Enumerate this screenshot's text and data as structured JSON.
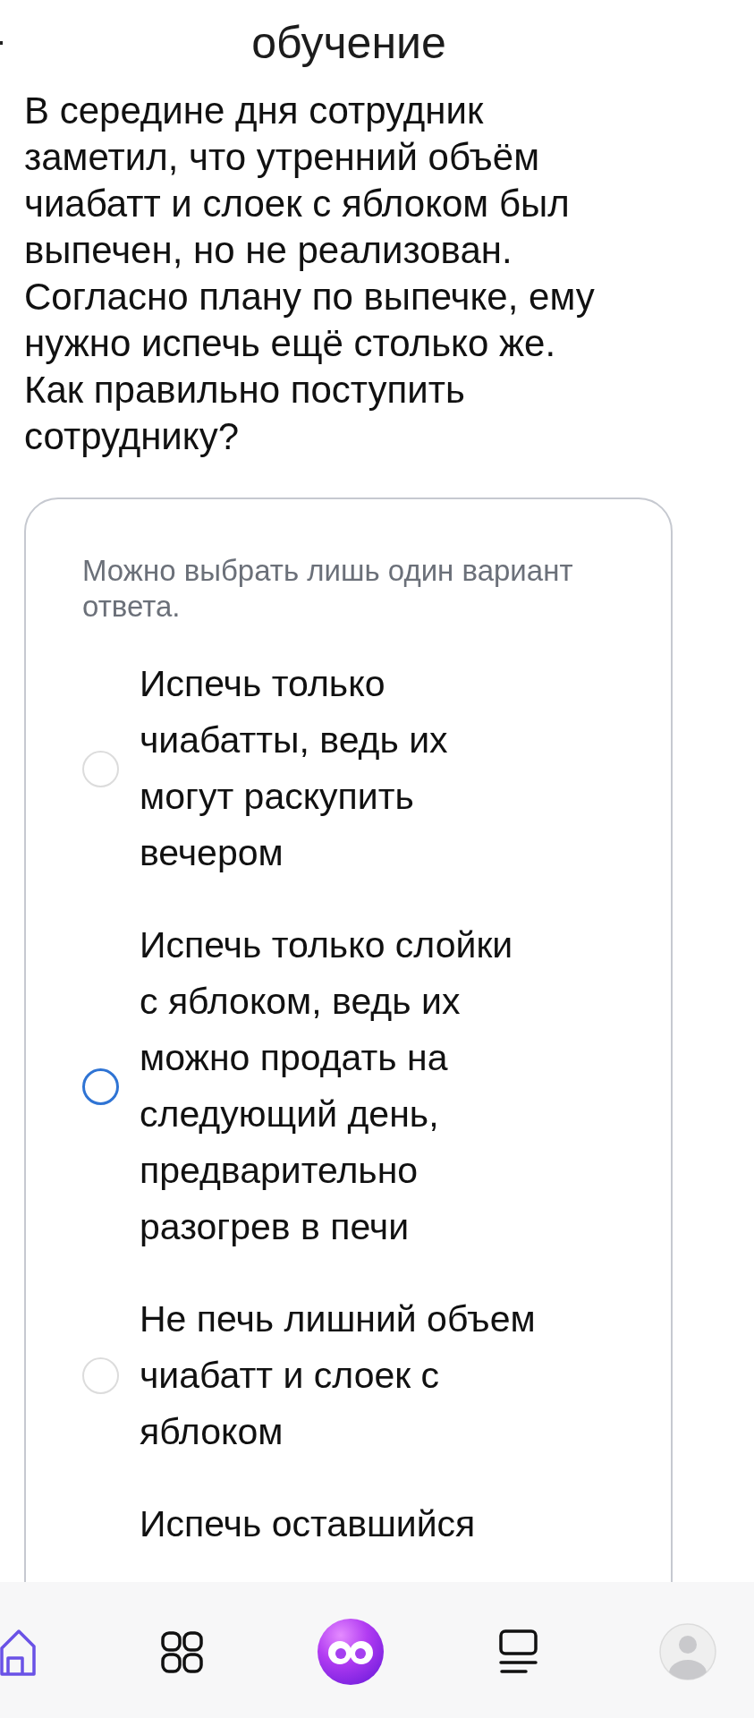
{
  "header": {
    "title": "обучение"
  },
  "question": {
    "text": "В середине дня сотрудник заметил, что утренний объём чиабатт и слоек с яблоком был выпечен, но не реализован. Согласно плану по выпечке, ему нужно испечь ещё столько же. Как правильно поступить сотруднику?"
  },
  "answer_card": {
    "hint": "Можно выбрать лишь один вариант ответа.",
    "options": [
      {
        "label": "Испечь только чиабатты, ведь их могут раскупить вечером",
        "selected": false
      },
      {
        "label": "Испечь только слойки с яблоком, ведь их можно продать на следующий день, предварительно разогрев в печи",
        "selected": true
      },
      {
        "label": "Не печь лишний объем чиабатт и слоек с яблоком",
        "selected": false
      },
      {
        "label": "Испечь оставшийся"
      }
    ]
  },
  "bottom_nav": {
    "items": [
      {
        "kind": "home",
        "selected": true
      },
      {
        "kind": "catalog",
        "selected": false
      },
      {
        "kind": "assistant",
        "selected": false
      },
      {
        "kind": "feed",
        "selected": false
      },
      {
        "kind": "profile",
        "selected": false
      }
    ]
  }
}
